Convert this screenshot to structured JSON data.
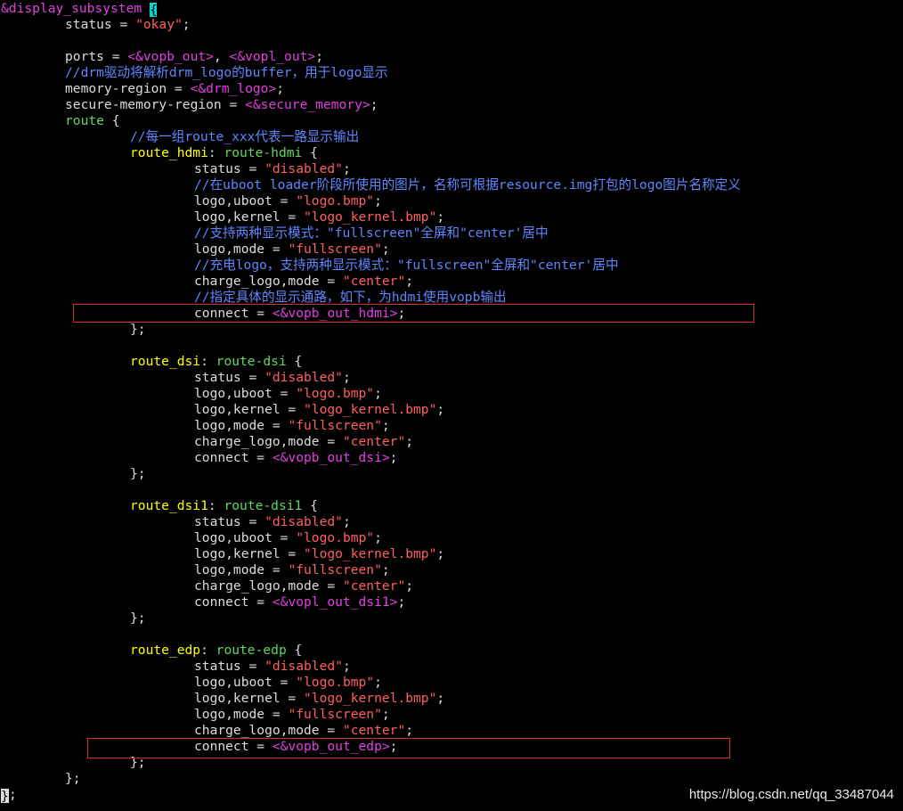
{
  "editor": {
    "cursor_char": "{",
    "lines": [
      {
        "ind": "ind0",
        "parts": [
          [
            "head",
            "&display_subsystem "
          ],
          [
            "cursor",
            "{"
          ]
        ]
      },
      {
        "ind": "ind1",
        "parts": [
          [
            "norm",
            "status = "
          ],
          [
            "str",
            "\"okay\""
          ],
          [
            "norm",
            ";"
          ]
        ]
      },
      {
        "ind": "ind1",
        "parts": []
      },
      {
        "ind": "ind1",
        "parts": [
          [
            "norm",
            "ports = "
          ],
          [
            "ref",
            "<&vopb_out>"
          ],
          [
            "norm",
            ", "
          ],
          [
            "ref",
            "<&vopl_out>"
          ],
          [
            "norm",
            ";"
          ]
        ]
      },
      {
        "ind": "ind1",
        "parts": [
          [
            "cmt",
            "//drm驱动将解析drm_logo的buffer，用于logo显示"
          ]
        ]
      },
      {
        "ind": "ind1",
        "parts": [
          [
            "norm",
            "memory-region = "
          ],
          [
            "ref",
            "<&drm_logo>"
          ],
          [
            "norm",
            ";"
          ]
        ]
      },
      {
        "ind": "ind1",
        "parts": [
          [
            "norm",
            "secure-memory-region = "
          ],
          [
            "ref",
            "<&secure_memory>"
          ],
          [
            "norm",
            ";"
          ]
        ]
      },
      {
        "ind": "ind1",
        "parts": [
          [
            "kw",
            "route"
          ],
          [
            "norm",
            " {"
          ]
        ]
      },
      {
        "ind": "ind2",
        "parts": [
          [
            "cmt",
            "//每一组route_xxx代表一路显示输出"
          ]
        ]
      },
      {
        "ind": "ind2",
        "parts": [
          [
            "label",
            "route_hdmi"
          ],
          [
            "norm",
            ": "
          ],
          [
            "kw",
            "route-hdmi"
          ],
          [
            "norm",
            " {"
          ]
        ]
      },
      {
        "ind": "ind3",
        "parts": [
          [
            "norm",
            "status = "
          ],
          [
            "str",
            "\"disabled\""
          ],
          [
            "norm",
            ";"
          ]
        ]
      },
      {
        "ind": "ind3",
        "parts": [
          [
            "cmt",
            "//在uboot loader阶段所使用的图片，名称可根据resource.img打包的logo图片名称定义"
          ]
        ]
      },
      {
        "ind": "ind3",
        "parts": [
          [
            "norm",
            "logo,uboot = "
          ],
          [
            "str",
            "\"logo.bmp\""
          ],
          [
            "norm",
            ";"
          ]
        ]
      },
      {
        "ind": "ind3",
        "parts": [
          [
            "norm",
            "logo,kernel = "
          ],
          [
            "str",
            "\"logo_kernel.bmp\""
          ],
          [
            "norm",
            ";"
          ]
        ]
      },
      {
        "ind": "ind3",
        "parts": [
          [
            "cmt",
            "//支持两种显示模式：\"fullscreen\"全屏和\"center'居中"
          ]
        ]
      },
      {
        "ind": "ind3",
        "parts": [
          [
            "norm",
            "logo,mode = "
          ],
          [
            "str",
            "\"fullscreen\""
          ],
          [
            "norm",
            ";"
          ]
        ]
      },
      {
        "ind": "ind3",
        "parts": [
          [
            "cmt",
            "//充电logo，支持两种显示模式：\"fullscreen\"全屏和\"center'居中"
          ]
        ]
      },
      {
        "ind": "ind3",
        "parts": [
          [
            "norm",
            "charge_logo,mode = "
          ],
          [
            "str",
            "\"center\""
          ],
          [
            "norm",
            ";"
          ]
        ]
      },
      {
        "ind": "ind3",
        "parts": [
          [
            "cmt",
            "//指定具体的显示通路，如下，为hdmi使用vopb输出"
          ]
        ]
      },
      {
        "ind": "ind3",
        "parts": [
          [
            "norm",
            "connect = "
          ],
          [
            "ref",
            "<&vopb_out_hdmi>"
          ],
          [
            "norm",
            ";"
          ]
        ]
      },
      {
        "ind": "ind2",
        "parts": [
          [
            "norm",
            "};"
          ]
        ]
      },
      {
        "ind": "ind2",
        "parts": []
      },
      {
        "ind": "ind2",
        "parts": [
          [
            "label",
            "route_dsi"
          ],
          [
            "norm",
            ": "
          ],
          [
            "kw",
            "route-dsi"
          ],
          [
            "norm",
            " {"
          ]
        ]
      },
      {
        "ind": "ind3",
        "parts": [
          [
            "norm",
            "status = "
          ],
          [
            "str",
            "\"disabled\""
          ],
          [
            "norm",
            ";"
          ]
        ]
      },
      {
        "ind": "ind3",
        "parts": [
          [
            "norm",
            "logo,uboot = "
          ],
          [
            "str",
            "\"logo.bmp\""
          ],
          [
            "norm",
            ";"
          ]
        ]
      },
      {
        "ind": "ind3",
        "parts": [
          [
            "norm",
            "logo,kernel = "
          ],
          [
            "str",
            "\"logo_kernel.bmp\""
          ],
          [
            "norm",
            ";"
          ]
        ]
      },
      {
        "ind": "ind3",
        "parts": [
          [
            "norm",
            "logo,mode = "
          ],
          [
            "str",
            "\"fullscreen\""
          ],
          [
            "norm",
            ";"
          ]
        ]
      },
      {
        "ind": "ind3",
        "parts": [
          [
            "norm",
            "charge_logo,mode = "
          ],
          [
            "str",
            "\"center\""
          ],
          [
            "norm",
            ";"
          ]
        ]
      },
      {
        "ind": "ind3",
        "parts": [
          [
            "norm",
            "connect = "
          ],
          [
            "ref",
            "<&vopb_out_dsi>"
          ],
          [
            "norm",
            ";"
          ]
        ]
      },
      {
        "ind": "ind2",
        "parts": [
          [
            "norm",
            "};"
          ]
        ]
      },
      {
        "ind": "ind2",
        "parts": []
      },
      {
        "ind": "ind2",
        "parts": [
          [
            "label",
            "route_dsi1"
          ],
          [
            "norm",
            ": "
          ],
          [
            "kw",
            "route-dsi1"
          ],
          [
            "norm",
            " {"
          ]
        ]
      },
      {
        "ind": "ind3",
        "parts": [
          [
            "norm",
            "status = "
          ],
          [
            "str",
            "\"disabled\""
          ],
          [
            "norm",
            ";"
          ]
        ]
      },
      {
        "ind": "ind3",
        "parts": [
          [
            "norm",
            "logo,uboot = "
          ],
          [
            "str",
            "\"logo.bmp\""
          ],
          [
            "norm",
            ";"
          ]
        ]
      },
      {
        "ind": "ind3",
        "parts": [
          [
            "norm",
            "logo,kernel = "
          ],
          [
            "str",
            "\"logo_kernel.bmp\""
          ],
          [
            "norm",
            ";"
          ]
        ]
      },
      {
        "ind": "ind3",
        "parts": [
          [
            "norm",
            "logo,mode = "
          ],
          [
            "str",
            "\"fullscreen\""
          ],
          [
            "norm",
            ";"
          ]
        ]
      },
      {
        "ind": "ind3",
        "parts": [
          [
            "norm",
            "charge_logo,mode = "
          ],
          [
            "str",
            "\"center\""
          ],
          [
            "norm",
            ";"
          ]
        ]
      },
      {
        "ind": "ind3",
        "parts": [
          [
            "norm",
            "connect = "
          ],
          [
            "ref",
            "<&vopl_out_dsi1>"
          ],
          [
            "norm",
            ";"
          ]
        ]
      },
      {
        "ind": "ind2",
        "parts": [
          [
            "norm",
            "};"
          ]
        ]
      },
      {
        "ind": "ind2",
        "parts": []
      },
      {
        "ind": "ind2",
        "parts": [
          [
            "label",
            "route_edp"
          ],
          [
            "norm",
            ": "
          ],
          [
            "kw",
            "route-edp"
          ],
          [
            "norm",
            " {"
          ]
        ]
      },
      {
        "ind": "ind3",
        "parts": [
          [
            "norm",
            "status = "
          ],
          [
            "str",
            "\"disabled\""
          ],
          [
            "norm",
            ";"
          ]
        ]
      },
      {
        "ind": "ind3",
        "parts": [
          [
            "norm",
            "logo,uboot = "
          ],
          [
            "str",
            "\"logo.bmp\""
          ],
          [
            "norm",
            ";"
          ]
        ]
      },
      {
        "ind": "ind3",
        "parts": [
          [
            "norm",
            "logo,kernel = "
          ],
          [
            "str",
            "\"logo_kernel.bmp\""
          ],
          [
            "norm",
            ";"
          ]
        ]
      },
      {
        "ind": "ind3",
        "parts": [
          [
            "norm",
            "logo,mode = "
          ],
          [
            "str",
            "\"fullscreen\""
          ],
          [
            "norm",
            ";"
          ]
        ]
      },
      {
        "ind": "ind3",
        "parts": [
          [
            "norm",
            "charge_logo,mode = "
          ],
          [
            "str",
            "\"center\""
          ],
          [
            "norm",
            ";"
          ]
        ]
      },
      {
        "ind": "ind3",
        "parts": [
          [
            "norm",
            "connect = "
          ],
          [
            "ref",
            "<&vopb_out_edp>"
          ],
          [
            "norm",
            ";"
          ]
        ]
      },
      {
        "ind": "ind2",
        "parts": [
          [
            "norm",
            "};"
          ]
        ]
      },
      {
        "ind": "ind1",
        "parts": [
          [
            "norm",
            "};"
          ]
        ]
      },
      {
        "ind": "ind0",
        "parts": [
          [
            "cursor2",
            "}"
          ],
          [
            "norm",
            ";"
          ]
        ]
      }
    ]
  },
  "watermark": "https://blog.csdn.net/qq_33487044",
  "colors": {
    "background": "#000000",
    "text": "#dcdcdc",
    "string": "#ff5f5f",
    "reference": "#e040e0",
    "label": "#ffff00",
    "comment": "#5f87ff",
    "keyword": "#5fd75f",
    "highlight_box": "#d03030",
    "cursor": "#00d7d7"
  }
}
